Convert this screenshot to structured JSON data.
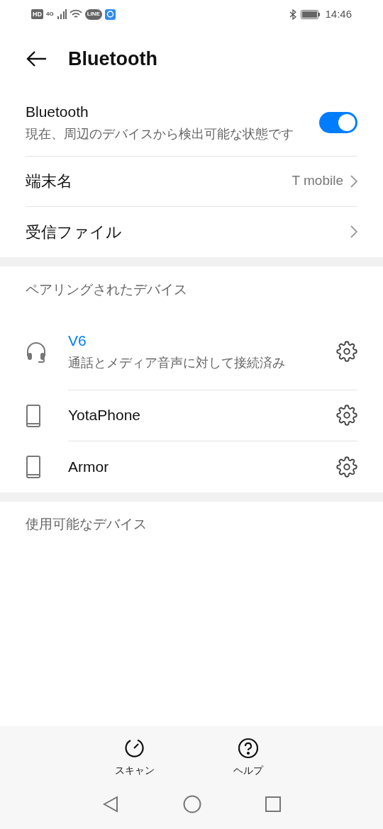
{
  "status_bar": {
    "badges": [
      "HD",
      "4G",
      "LINE"
    ],
    "time": "14:46"
  },
  "header": {
    "title": "Bluetooth"
  },
  "bluetooth": {
    "title": "Bluetooth",
    "subtitle": "現在、周辺のデバイスから検出可能な状態です",
    "on": true
  },
  "settings": [
    {
      "label": "端末名",
      "value": "T mobile"
    },
    {
      "label": "受信ファイル"
    }
  ],
  "paired": {
    "heading": "ペアリングされたデバイス",
    "devices": [
      {
        "kind": "headset",
        "name": "V6",
        "status": "通話とメディア音声に対して接続済み",
        "connected": true
      },
      {
        "kind": "phone",
        "name": "YotaPhone",
        "connected": false
      },
      {
        "kind": "phone",
        "name": "Armor",
        "connected": false
      }
    ]
  },
  "available": {
    "heading": "使用可能なデバイス"
  },
  "bottom_actions": [
    {
      "kind": "scan",
      "label": "スキャン"
    },
    {
      "kind": "help",
      "label": "ヘルプ"
    }
  ]
}
